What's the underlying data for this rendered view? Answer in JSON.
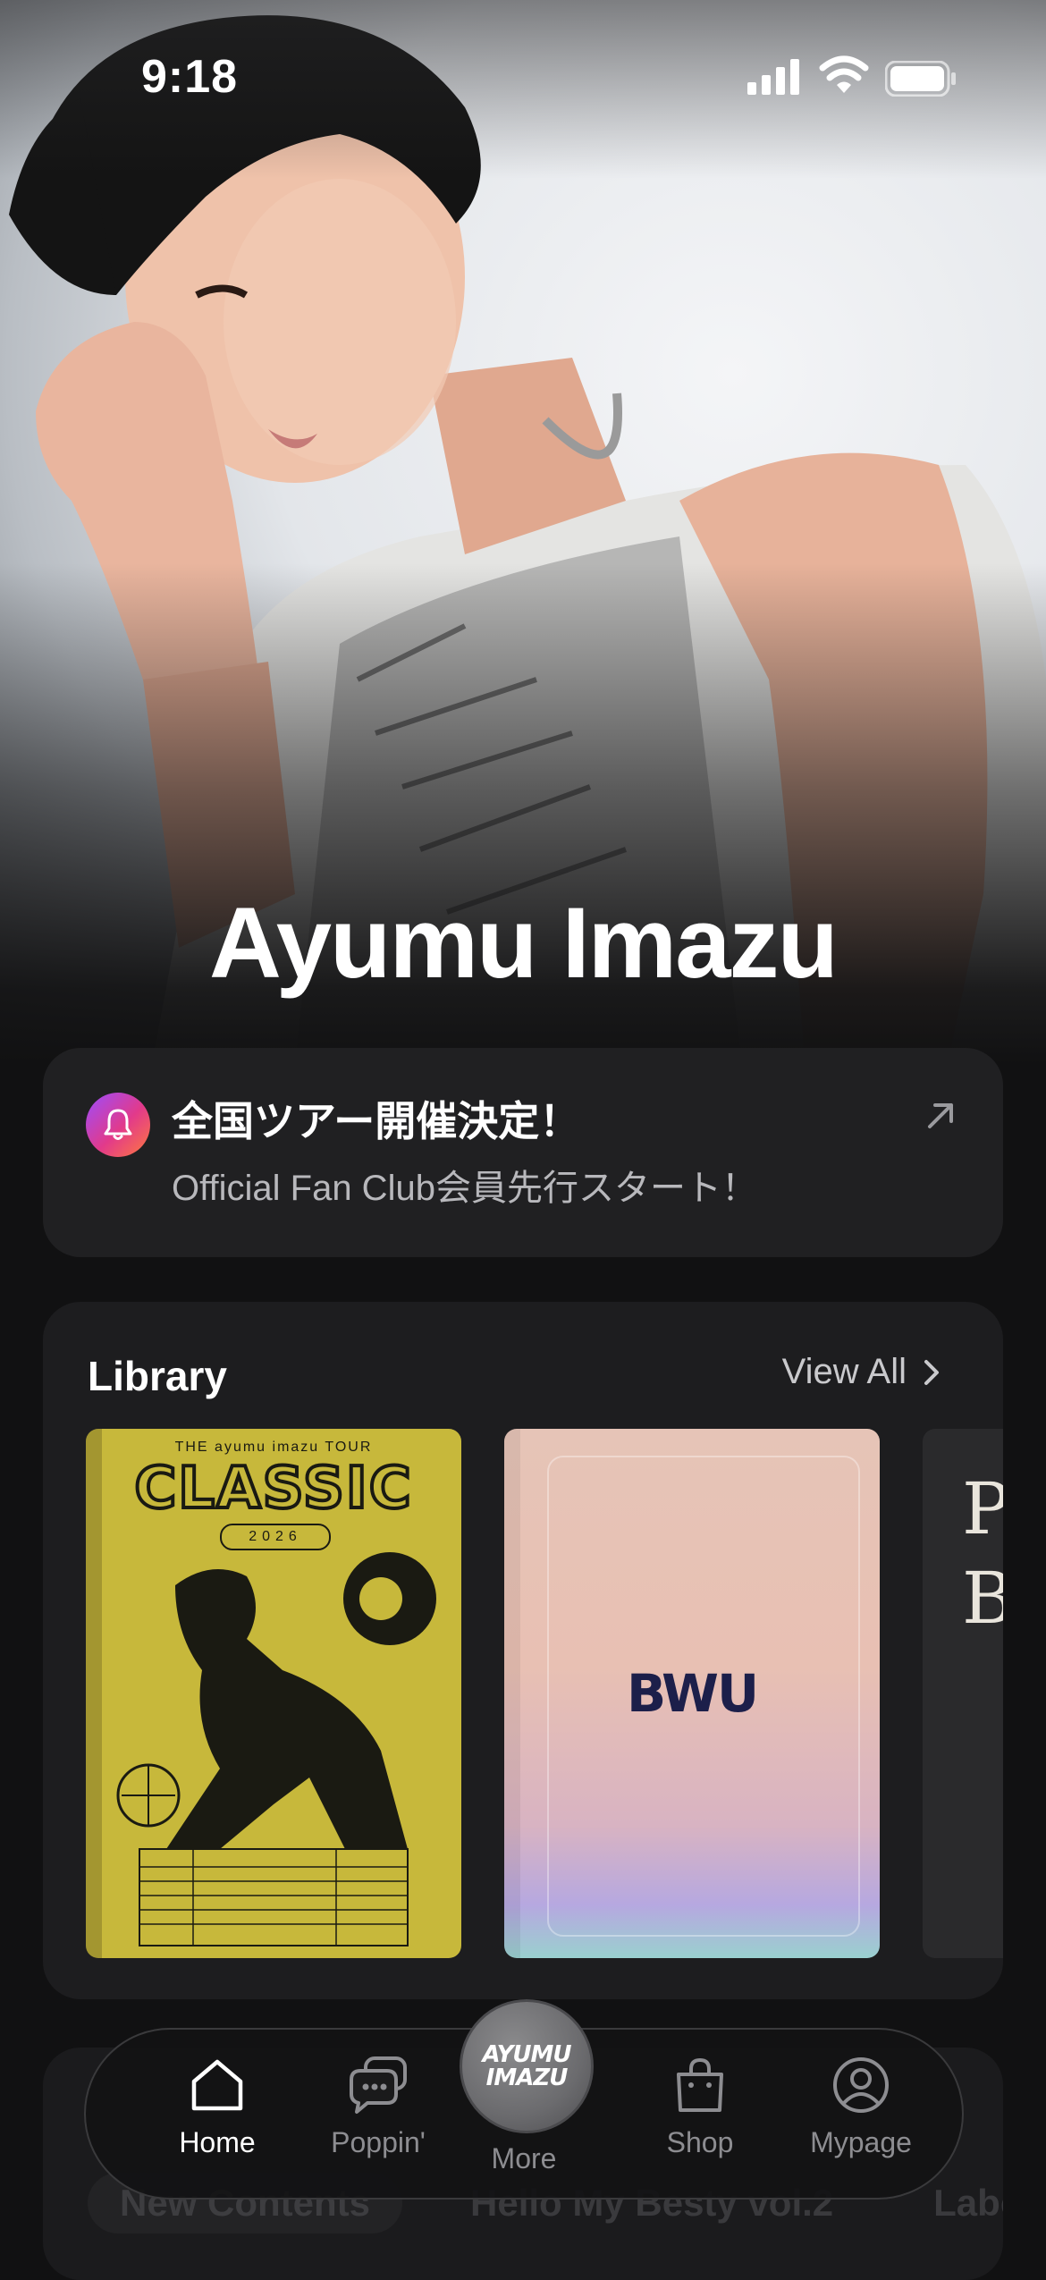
{
  "status_bar": {
    "time": "9:18"
  },
  "hero": {
    "artist_name": "Ayumu Imazu"
  },
  "notice": {
    "title": "全国ツアー開催決定！",
    "subtitle": "Official Fan Club会員先行スタート！",
    "icon": "bell-icon"
  },
  "library": {
    "title": "Library",
    "view_all": "View All",
    "items": [
      {
        "top_text": "THE  ayumu imazu  TOUR",
        "title": "CLASSIC",
        "year": "2026"
      },
      {
        "logo": "BWU"
      },
      {
        "text": "P\nB"
      }
    ]
  },
  "contents": {
    "chips": [
      "New Contents",
      "Hello My Besty vol.2",
      "Labe"
    ]
  },
  "tabbar": {
    "tabs": [
      {
        "label": "Home",
        "icon": "home-icon"
      },
      {
        "label": "Poppin'",
        "icon": "chat-bubbles-icon"
      },
      {
        "label": "More",
        "logo": "AYUMU\nIMAZU"
      },
      {
        "label": "Shop",
        "icon": "shopping-bag-icon"
      },
      {
        "label": "Mypage",
        "icon": "user-icon"
      }
    ]
  }
}
